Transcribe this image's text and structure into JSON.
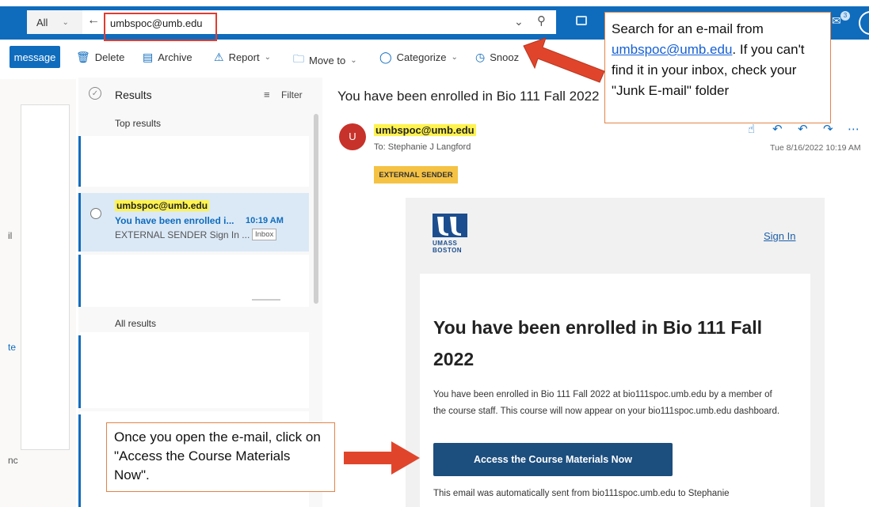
{
  "search": {
    "scope": "All",
    "query": "umbspoc@umb.edu"
  },
  "toolbar": {
    "new_message": "message",
    "delete": "Delete",
    "archive": "Archive",
    "report": "Report",
    "move_to": "Move to",
    "categorize": "Categorize",
    "snooze": "Snooz"
  },
  "nav_fragments": [
    "il",
    "te",
    "nc"
  ],
  "results": {
    "header": "Results",
    "filter": "Filter",
    "top_results": "Top results",
    "all_results": "All results",
    "selected": {
      "sender": "umbspoc@umb.edu",
      "subject": "You have been enrolled i...",
      "time": "10:19 AM",
      "preview": "EXTERNAL SENDER Sign In ...",
      "folder_badge": "Inbox"
    }
  },
  "reading": {
    "title": "You have been enrolled in Bio 111 Fall 2022",
    "avatar_letter": "U",
    "from": "umbspoc@umb.edu",
    "to": "To:  Stephanie J Langford",
    "date": "Tue 8/16/2022 10:19 AM",
    "external_badge": "EXTERNAL SENDER"
  },
  "email": {
    "logo_line1": "UMASS",
    "logo_line2": "BOSTON",
    "sign_in": "Sign In",
    "heading": "You have been enrolled in Bio 111 Fall 2022",
    "paragraph": "You have been enrolled in Bio 111 Fall 2022 at bio111spoc.umb.edu by a member of the course staff. This course will now appear on your bio111spoc.umb.edu dashboard.",
    "cta": "Access the Course Materials Now",
    "footer": "This email was automatically sent from bio111spoc.umb.edu to Stephanie"
  },
  "callouts": {
    "search_pre": "Search for an e-mail from ",
    "search_link": "umbspoc@umb.edu",
    "search_post": ". If you can't find it in your inbox, check your \"Junk E-mail\" folder",
    "open": "Once you open the e-mail, click on \"Access the Course Materials Now\"."
  },
  "colors": {
    "brand_blue": "#0f6cbd",
    "highlight": "#fff34d",
    "arrow_red": "#e0452c",
    "callout_border": "#e2844a"
  }
}
